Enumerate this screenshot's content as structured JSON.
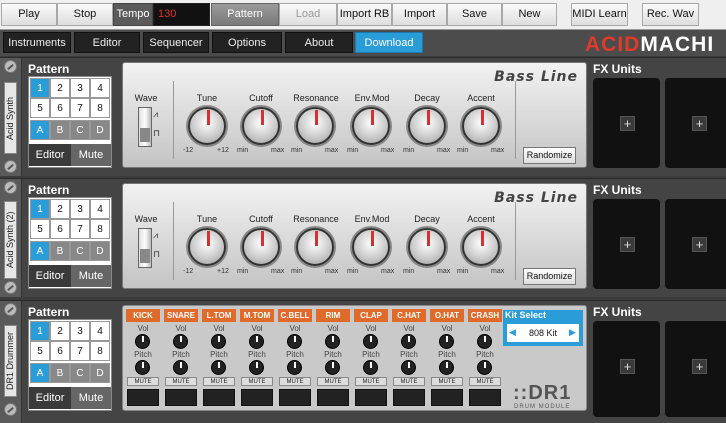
{
  "toolbar": {
    "play": "Play",
    "stop": "Stop",
    "tempo_label": "Tempo",
    "tempo_value": "130",
    "pattern_mode": "Pattern Mode",
    "load": "Load",
    "import_rb": "Import RB",
    "import_abl": "Import ABL",
    "save": "Save",
    "new": "New",
    "midi_learn": "MIDI Learn",
    "rec_wav": "Rec. Wav"
  },
  "nav": {
    "instruments": "Instruments",
    "editor": "Editor",
    "sequencer": "Sequencer",
    "options": "Options",
    "about": "About",
    "download": "Download App"
  },
  "logo": {
    "a": "ACID",
    "b": "MACHI"
  },
  "modules": [
    {
      "name": "Acid Synth",
      "pattern_title": "Pattern",
      "pads": [
        "1",
        "2",
        "3",
        "4",
        "5",
        "6",
        "7",
        "8"
      ],
      "banks": [
        "A",
        "B",
        "C",
        "D"
      ],
      "editor": "Editor",
      "mute": "Mute",
      "synth_name": "Bass Line",
      "wave_label": "Wave",
      "knobs": [
        "Tune",
        "Cutoff",
        "Resonance",
        "Env.Mod",
        "Decay",
        "Accent"
      ],
      "randomize": "Randomize",
      "fx_title": "FX Units",
      "fx_add": "+"
    },
    {
      "name": "Acid Synth (2)",
      "pattern_title": "Pattern",
      "pads": [
        "1",
        "2",
        "3",
        "4",
        "5",
        "6",
        "7",
        "8"
      ],
      "banks": [
        "A",
        "B",
        "C",
        "D"
      ],
      "editor": "Editor",
      "mute": "Mute",
      "synth_name": "Bass Line",
      "wave_label": "Wave",
      "knobs": [
        "Tune",
        "Cutoff",
        "Resonance",
        "Env.Mod",
        "Decay",
        "Accent"
      ],
      "randomize": "Randomize",
      "fx_title": "FX Units",
      "fx_add": "+"
    },
    {
      "name": "DR1 Drummer",
      "pattern_title": "Pattern",
      "pads": [
        "1",
        "2",
        "3",
        "4",
        "5",
        "6",
        "7",
        "8"
      ],
      "banks": [
        "A",
        "B",
        "C",
        "D"
      ],
      "editor": "Editor",
      "mute": "Mute",
      "fx_title": "FX Units",
      "fx_add": "+"
    }
  ],
  "knob_ranges": {
    "tune_min": "-12",
    "tune_max": "+12",
    "min": "min",
    "max": "max"
  },
  "drum": {
    "channels": [
      "KICK",
      "SNARE",
      "L.TOM",
      "M.TOM",
      "C.BELL",
      "RIM",
      "CLAP",
      "C.HAT",
      "O.HAT",
      "CRASH"
    ],
    "vol": "Vol",
    "pitch": "Pitch",
    "mute": "MUTE",
    "kit_select": "Kit Select",
    "kit_value": "808 Kit",
    "left_arrow": "◀",
    "right_arrow": "▶",
    "logo": "::DR1",
    "logo_sub": "DRUM MODULE"
  },
  "colors": {
    "accent": "#2a9cd8",
    "knob_indicator": "#d63030",
    "drum_label": "#e06a2a"
  }
}
